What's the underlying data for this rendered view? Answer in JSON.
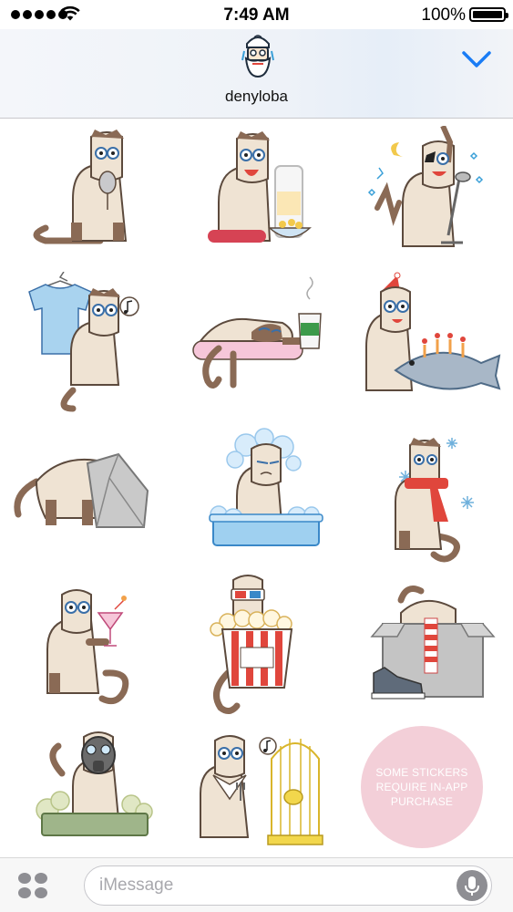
{
  "status_bar": {
    "time": "7:49 AM",
    "battery_percent": "100%",
    "signal_icon": "signal-dots-icon",
    "wifi_icon": "wifi-icon",
    "battery_icon": "battery-icon"
  },
  "header": {
    "contact_name": "denyloba",
    "avatar_icon": "bearded-man-avatar-icon",
    "collapse_icon": "chevron-down-icon",
    "accent_color": "#1a7cf5"
  },
  "stickers": [
    {
      "name": "cat-with-mouse-sticker"
    },
    {
      "name": "cat-with-sausage-milk-cereal-sticker"
    },
    {
      "name": "rockstar-cat-with-microphone-sticker"
    },
    {
      "name": "cat-with-tshirt-humming-sticker"
    },
    {
      "name": "sleeping-cat-with-coffee-sticker"
    },
    {
      "name": "birthday-cat-with-fish-cake-sticker"
    },
    {
      "name": "cat-hiding-head-in-paper-bag-sticker"
    },
    {
      "name": "cat-in-bath-with-foam-sticker"
    },
    {
      "name": "cat-with-scarf-snowflakes-sticker"
    },
    {
      "name": "cat-with-cocktail-sticker"
    },
    {
      "name": "cat-with-3d-glasses-popcorn-sticker"
    },
    {
      "name": "cat-in-box-with-sneaker-sticker"
    },
    {
      "name": "cat-with-gas-mask-litter-box-sticker"
    },
    {
      "name": "hungry-cat-with-bird-cage-sticker"
    }
  ],
  "promo": {
    "text": "SOME STICKERS REQUIRE IN-APP PURCHASE",
    "color": "#f3cfd8"
  },
  "input_bar": {
    "placeholder": "iMessage",
    "apps_icon": "app-drawer-icon",
    "mic_icon": "microphone-icon"
  }
}
